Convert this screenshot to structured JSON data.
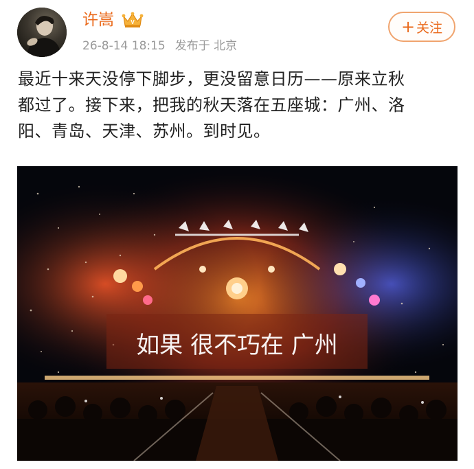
{
  "user": {
    "name": "许嵩",
    "badge_icon": "crown-vip-icon",
    "avatar_icon": "avatar-photo"
  },
  "post_meta": {
    "datetime": "26-8-14 18:15",
    "location": "发布于 北京"
  },
  "follow_button": {
    "icon": "plus-icon",
    "plus": "+",
    "label": "关注"
  },
  "post": {
    "lines": [
      "最近十来天没停下脚步，更没留意日历——原来立秋",
      "都过了。接下来，把我的秋天落在五座城：广州、洛",
      "阳、青岛、天津、苏州。到时见。"
    ]
  },
  "photo": {
    "description_icon": "concert-stage-photo",
    "stage_caption": "如果 很不巧在 广州"
  },
  "colors": {
    "accent": "#ea6a1c",
    "meta_text": "#9a9a9a",
    "body_text": "#222222",
    "button_border": "#f0a46e"
  }
}
